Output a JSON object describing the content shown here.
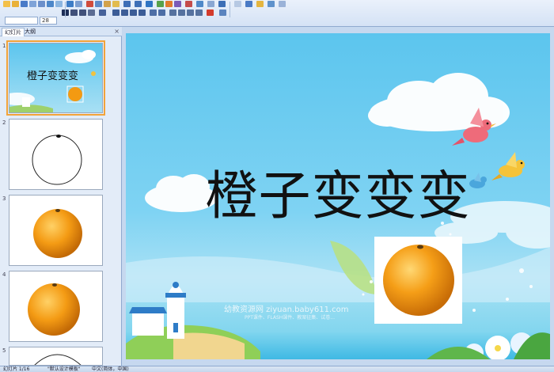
{
  "toolbar": {
    "font_size": "28"
  },
  "left_pane": {
    "tabs": [
      "幻灯片",
      "大纲"
    ],
    "close": "×",
    "thumbs": [
      {
        "num": "1",
        "title": "橙子变变变"
      },
      {
        "num": "2"
      },
      {
        "num": "3"
      },
      {
        "num": "4"
      },
      {
        "num": "5"
      }
    ]
  },
  "slide": {
    "title": "橙子变变变",
    "watermark": "幼教资源网 ziyuan.baby611.com",
    "watermark_sub": "PPT课件、FLASH课件、教案征集、试卷..."
  },
  "statusbar": {
    "slide_count": "幻灯片 1/16",
    "theme": "\"默认设计模板\"",
    "language": "中文(简体，中国)"
  },
  "colors": {
    "sky": "#5cc5ee",
    "orange": "#f39a12",
    "selection": "#f2a33a"
  }
}
